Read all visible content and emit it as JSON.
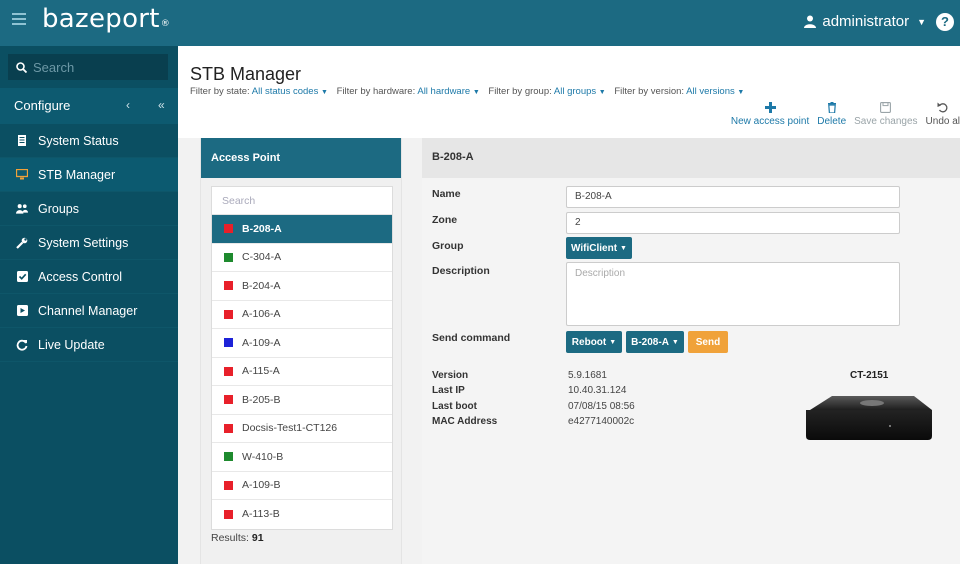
{
  "header": {
    "logo_text": "bazeport",
    "logo_mark": "®",
    "user_label": "administrator",
    "help_label": "?"
  },
  "sidebar": {
    "search_placeholder": "Search",
    "configure_label": "Configure",
    "collapse_label": "‹",
    "collapse_all_label": "«",
    "items": [
      {
        "label": "System Status",
        "icon": "server-icon"
      },
      {
        "label": "STB Manager",
        "icon": "monitor-icon"
      },
      {
        "label": "Groups",
        "icon": "users-icon"
      },
      {
        "label": "System Settings",
        "icon": "wrench-icon"
      },
      {
        "label": "Access Control",
        "icon": "checkbox-icon"
      },
      {
        "label": "Channel Manager",
        "icon": "tv-icon"
      },
      {
        "label": "Live Update",
        "icon": "refresh-icon"
      }
    ]
  },
  "page": {
    "title": "STB Manager",
    "filters": [
      {
        "label": "Filter by state:",
        "value": "All status codes"
      },
      {
        "label": "Filter by hardware:",
        "value": "All hardware"
      },
      {
        "label": "Filter by group:",
        "value": "All groups"
      },
      {
        "label": "Filter by version:",
        "value": "All versions"
      }
    ],
    "toolbar": {
      "new_label": "New access point",
      "delete_label": "Delete",
      "save_label": "Save changes",
      "undo_label": "Undo al"
    }
  },
  "access_points": {
    "header": "Access Point",
    "search_placeholder": "Search",
    "items": [
      {
        "name": "B-208-A",
        "status_color": "#e8202a"
      },
      {
        "name": "C-304-A",
        "status_color": "#1e8a2e"
      },
      {
        "name": "B-204-A",
        "status_color": "#e8202a"
      },
      {
        "name": "A-106-A",
        "status_color": "#e8202a"
      },
      {
        "name": "A-109-A",
        "status_color": "#1d22d8"
      },
      {
        "name": "A-115-A",
        "status_color": "#e8202a"
      },
      {
        "name": "B-205-B",
        "status_color": "#e8202a"
      },
      {
        "name": "Docsis-Test1-CT126",
        "status_color": "#e8202a"
      },
      {
        "name": "W-410-B",
        "status_color": "#1e8a2e"
      },
      {
        "name": "A-109-B",
        "status_color": "#e8202a"
      },
      {
        "name": "A-113-B",
        "status_color": "#e8202a"
      }
    ],
    "selected_index": 0,
    "results_label": "Results:",
    "results_count": "91"
  },
  "detail": {
    "header": "B-208-A",
    "name_label": "Name",
    "name_value": "B-208-A",
    "zone_label": "Zone",
    "zone_value": "2",
    "group_label": "Group",
    "group_value": "WifiClient",
    "description_label": "Description",
    "description_placeholder": "Description",
    "send_command_label": "Send command",
    "command_value": "Reboot",
    "target_value": "B-208-A",
    "send_label": "Send",
    "version_label": "Version",
    "version_value": "5.9.1681",
    "last_ip_label": "Last IP",
    "last_ip_value": "10.40.31.124",
    "last_boot_label": "Last boot",
    "last_boot_value": "07/08/15 08:56",
    "mac_label": "MAC Address",
    "mac_value": "e4277140002c",
    "model": "CT-2151"
  },
  "colors": {
    "topbar": "#1c6a82",
    "sidebar": "#0b4f62",
    "accent": "#1c6a82",
    "send": "#f0a23a"
  }
}
